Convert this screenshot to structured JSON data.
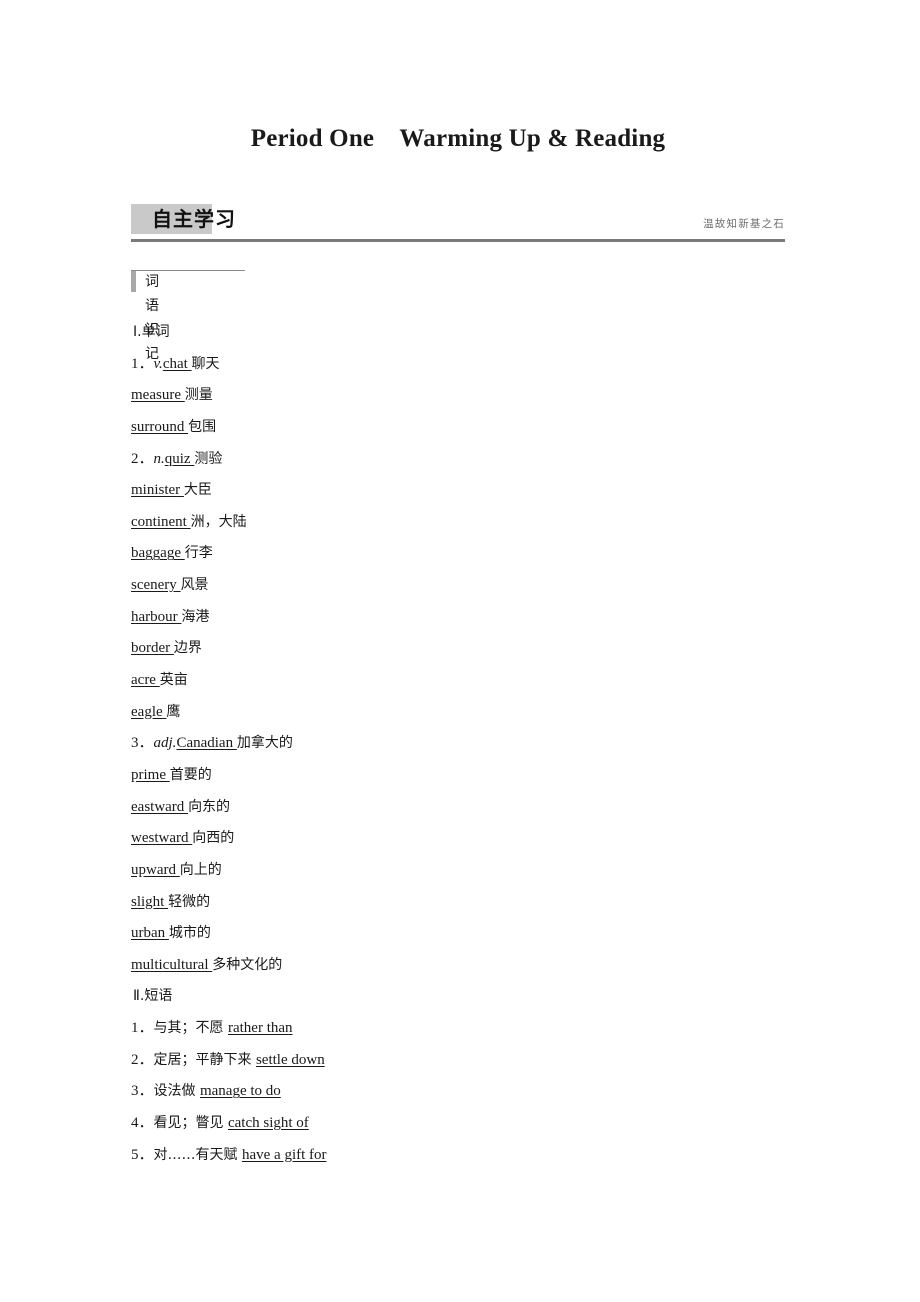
{
  "document": {
    "title": "Period One　Warming Up & Reading"
  },
  "section": {
    "band_title": "自主学习",
    "band_motto": "温故知新基之石"
  },
  "subsection": {
    "label": "词语识记"
  },
  "content": {
    "words_heading": "Ⅰ.单词",
    "phrases_heading": "Ⅱ.短语",
    "words": [
      {
        "num": "1．",
        "pos": "v.",
        "word": "chat ",
        "meaning": "聊天"
      },
      {
        "num": "",
        "pos": "",
        "word": "measure ",
        "meaning": "测量"
      },
      {
        "num": "",
        "pos": "",
        "word": "surround ",
        "meaning": "包围"
      },
      {
        "num": "2．",
        "pos": "n.",
        "word": "quiz ",
        "meaning": "测验"
      },
      {
        "num": "",
        "pos": "",
        "word": "minister ",
        "meaning": "大臣"
      },
      {
        "num": "",
        "pos": "",
        "word": "continent ",
        "meaning": "洲，大陆"
      },
      {
        "num": "",
        "pos": "",
        "word": "baggage ",
        "meaning": "行李"
      },
      {
        "num": "",
        "pos": "",
        "word": "scenery ",
        "meaning": "风景"
      },
      {
        "num": "",
        "pos": "",
        "word": "harbour ",
        "meaning": "海港"
      },
      {
        "num": "",
        "pos": "",
        "word": "border ",
        "meaning": "边界"
      },
      {
        "num": "",
        "pos": "",
        "word": "acre ",
        "meaning": "英亩"
      },
      {
        "num": "",
        "pos": "",
        "word": "eagle ",
        "meaning": "鹰"
      },
      {
        "num": "3．",
        "pos": "adj.",
        "word": "Canadian ",
        "meaning": "加拿大的"
      },
      {
        "num": "",
        "pos": "",
        "word": "prime ",
        "meaning": "首要的"
      },
      {
        "num": "",
        "pos": "",
        "word": "eastward ",
        "meaning": "向东的"
      },
      {
        "num": "",
        "pos": "",
        "word": "westward ",
        "meaning": "向西的"
      },
      {
        "num": "",
        "pos": "",
        "word": "upward ",
        "meaning": "向上的"
      },
      {
        "num": "",
        "pos": "",
        "word": "slight ",
        "meaning": "轻微的"
      },
      {
        "num": "",
        "pos": "",
        "word": "urban ",
        "meaning": "城市的"
      },
      {
        "num": "",
        "pos": "",
        "word": "multicultural ",
        "meaning": "多种文化的"
      }
    ],
    "phrases": [
      {
        "num": "1．",
        "meaning": "与其；不愿 ",
        "phrase": "rather than"
      },
      {
        "num": "2．",
        "meaning": "定居；平静下来 ",
        "phrase": "settle down"
      },
      {
        "num": "3．",
        "meaning": "设法做 ",
        "phrase": "manage to do"
      },
      {
        "num": "4．",
        "meaning": "看见；瞥见 ",
        "phrase": "catch sight of"
      },
      {
        "num": "5．",
        "meaning": "对……有天赋 ",
        "phrase": "have a gift for"
      }
    ]
  }
}
